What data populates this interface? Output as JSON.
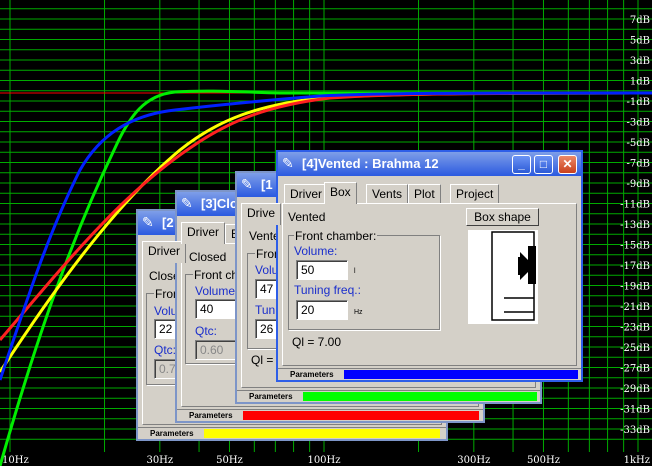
{
  "graph": {
    "y_labels": [
      "7dB",
      "5dB",
      "3dB",
      "1dB",
      "-1dB",
      "-3dB",
      "-5dB",
      "-7dB",
      "-9dB",
      "-11dB",
      "-13dB",
      "-15dB",
      "-17dB",
      "-19dB",
      "-21dB",
      "-23dB",
      "-25dB",
      "-27dB",
      "-29dB",
      "-31dB",
      "-33dB"
    ],
    "x_labels": [
      "10Hz",
      "30Hz",
      "50Hz",
      "100Hz",
      "300Hz",
      "500Hz",
      "1kHz"
    ],
    "colors": {
      "background": "#000000",
      "grid": "#00aa00",
      "zero_line": "#ff0000"
    }
  },
  "dialogs": {
    "d2": {
      "title": "[2",
      "tab_driver": "Driver",
      "type_value": "Close",
      "group_label": "Front",
      "volume_label": "Volu",
      "volume_value": "22",
      "qtc_label": "Qtc:",
      "qtc_value": "0.7",
      "status_label": "Parameters",
      "bar_color": "#ffff00"
    },
    "d3": {
      "title": "[3]Clo",
      "tab_driver": "Driver",
      "tab_box": "Bo",
      "type_value": "Closed",
      "group_label": "Front cha",
      "volume_label": "Volume:",
      "volume_value": "40",
      "qtc_label": "Qtc:",
      "qtc_value": "0.60",
      "status_label": "Parameters",
      "bar_color": "#ff0000"
    },
    "d1": {
      "title": "[1",
      "tab_driver": "Drive",
      "type_value": "Vente",
      "group_label": "Fron",
      "volume_label": "Volu",
      "volume_value": "47",
      "tuning_label": "Tuni",
      "tuning_value": "26",
      "ql_label": "Ql = 7",
      "status_label": "Parameters",
      "bar_color": "#00ff00"
    },
    "d4": {
      "title": "[4]Vented : Brahma 12",
      "tabs": [
        "Driver",
        "Box",
        "Vents",
        "Plot",
        "Project"
      ],
      "type_value": "Vented",
      "box_shape_button": "Box shape",
      "group_label": "Front chamber:",
      "volume_label": "Volume:",
      "volume_value": "50",
      "volume_unit": "l",
      "tuning_label": "Tuning freq.:",
      "tuning_value": "20",
      "tuning_unit": "Hz",
      "ql_label": "Ql = 7.00",
      "status_label": "Parameters",
      "bar_color": "#0000ff"
    }
  }
}
